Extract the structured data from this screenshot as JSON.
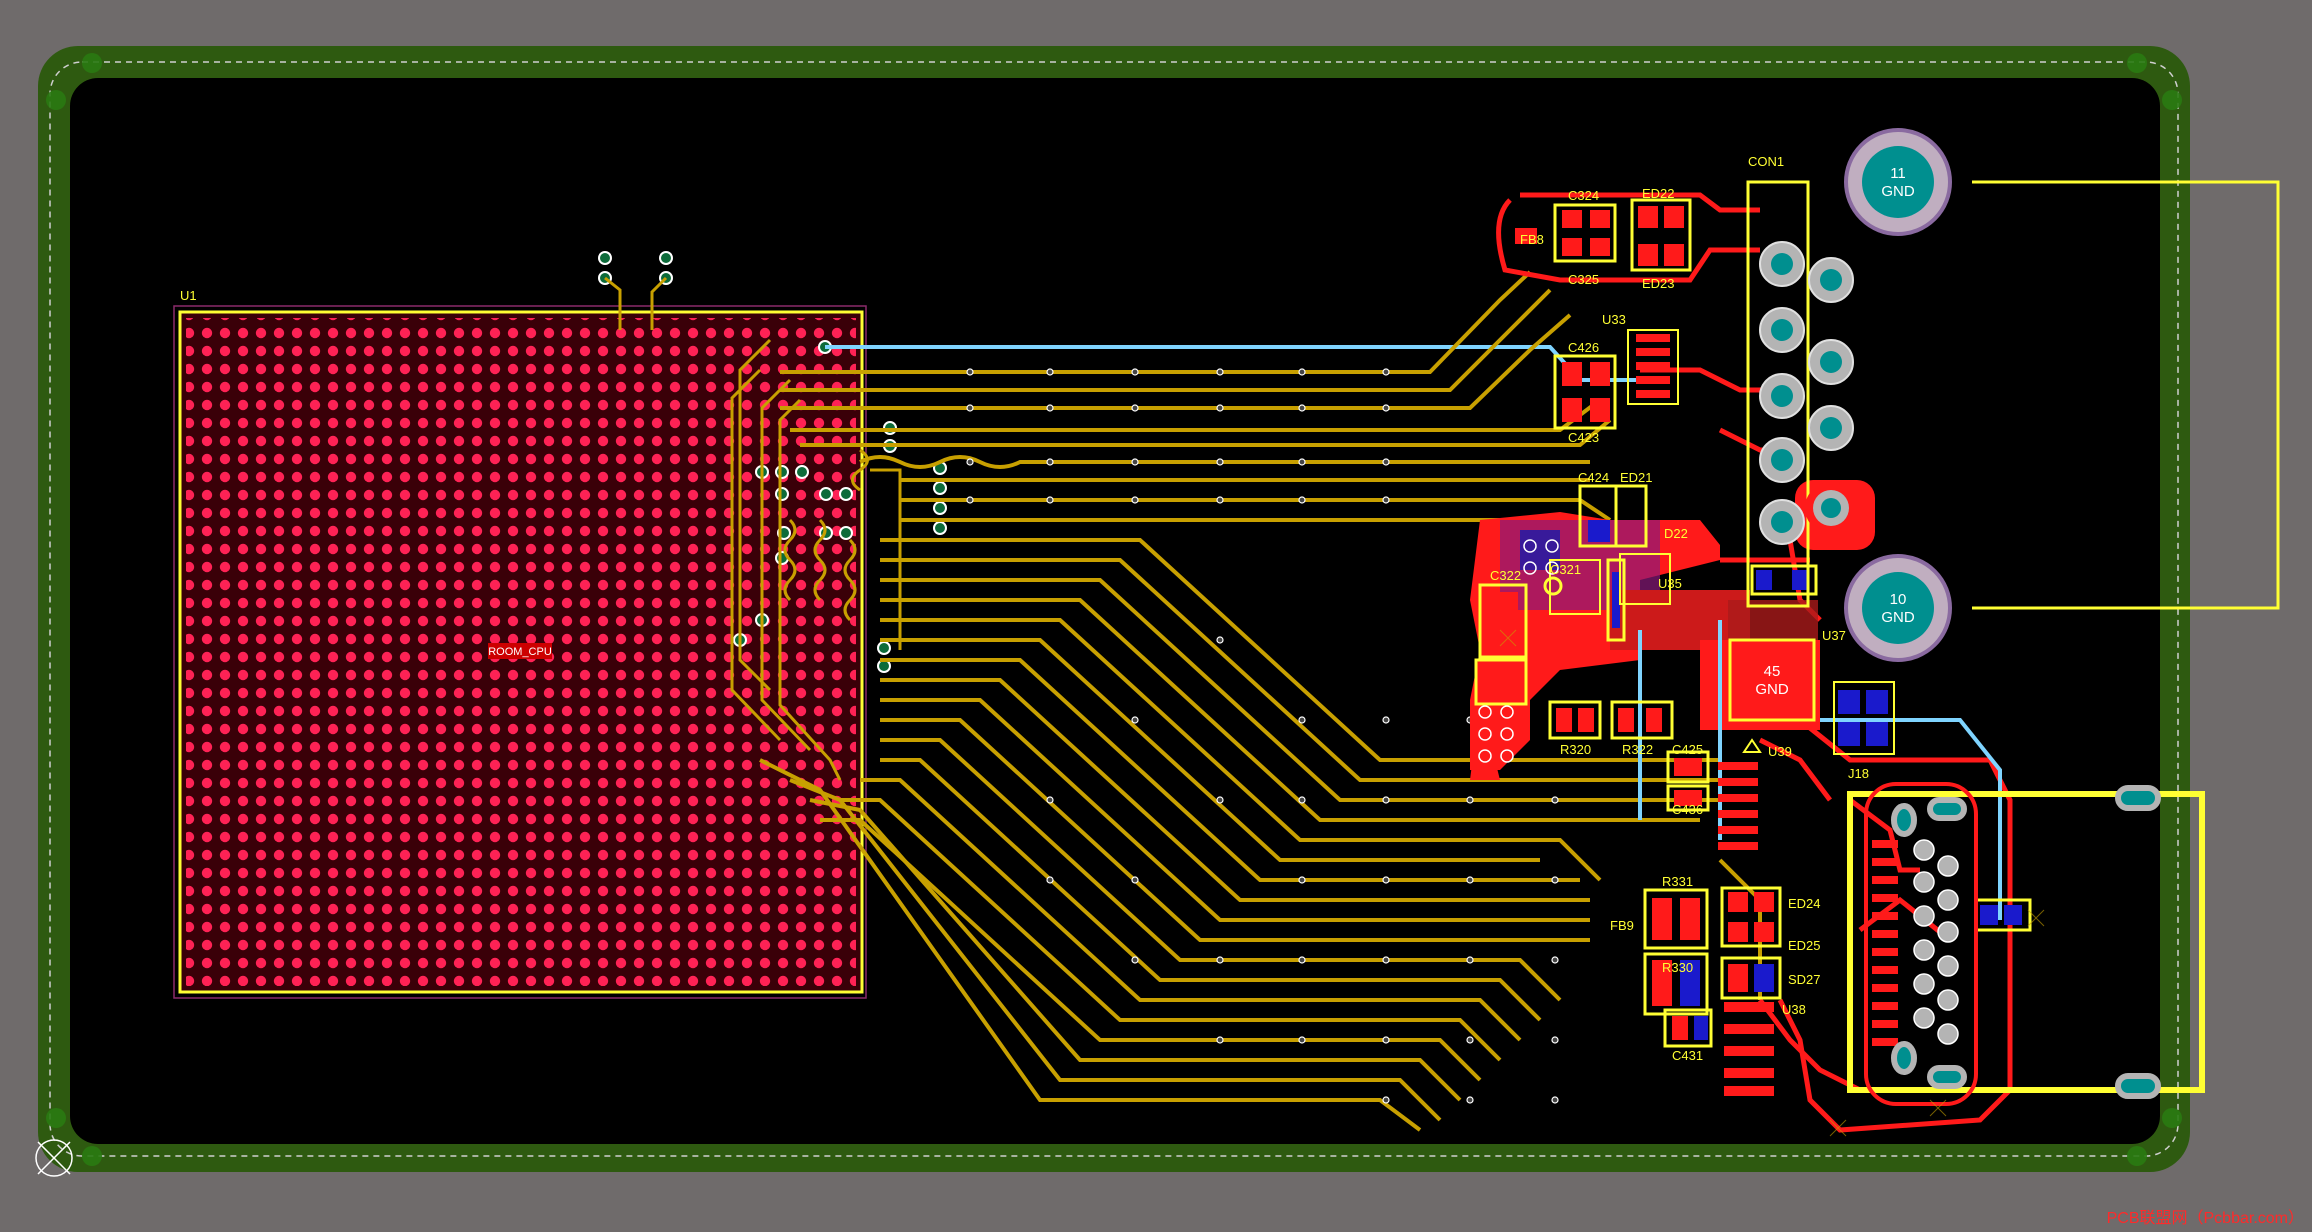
{
  "board": {
    "background_color": "#6f6b6b",
    "board_color": "#000000",
    "outline_color": "#2e5a10",
    "top_copper_color": "#ff1a1a",
    "trace_color": "#c8a000",
    "signal_trace_color": "#7fd4ff",
    "silkscreen_color": "#ffff33",
    "cpu_fill_color": "#3a0008",
    "ball_color": "#ff2255",
    "gnd_pad_color": "#008f8f"
  },
  "components": {
    "u1": {
      "ref": "U1",
      "label": "ROOM_CPU"
    },
    "con1": {
      "ref": "CON1"
    },
    "pad_11": {
      "pin": "11",
      "net": "GND"
    },
    "pad_10": {
      "pin": "10",
      "net": "GND"
    },
    "pad_45": {
      "pin": "45",
      "net": "GND"
    },
    "refs": [
      "C324",
      "ED22",
      "FB8",
      "C325",
      "ED23",
      "U33",
      "C426",
      "C423",
      "C424",
      "ED21",
      "D22",
      "C322",
      "C321",
      "U35",
      "U37",
      "R320",
      "R322",
      "C425",
      "U39",
      "J18",
      "C436",
      "R331",
      "FB9",
      "R330",
      "ED24",
      "ED25",
      "SD27",
      "U38",
      "C431"
    ]
  },
  "watermark": "PCB联盟网（Pcbbar.com）"
}
